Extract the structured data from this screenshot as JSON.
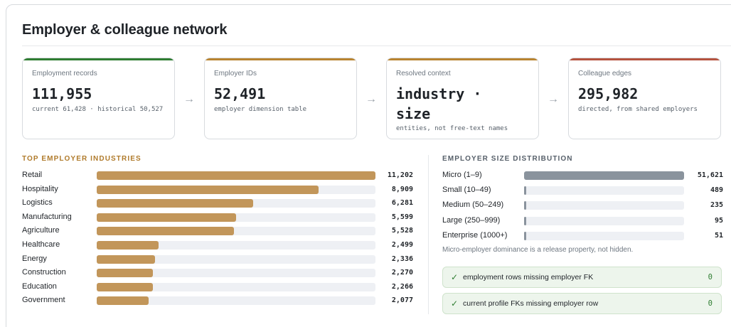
{
  "header": {
    "title": "Employer & colleague network"
  },
  "colors": {
    "green": "#2f7d32",
    "gold": "#c2965a",
    "amber": "#b98430",
    "red": "#b5533f",
    "grey_bar": "#8a939d",
    "section_gold": "#b07b2c"
  },
  "pipeline": {
    "arrow": "→",
    "cards": [
      {
        "label": "Employment records",
        "value": "111,955",
        "sub": "current 61,428 · historical 50,527",
        "accent": "#2f7d32"
      },
      {
        "label": "Employer IDs",
        "value": "52,491",
        "sub": "employer dimension table",
        "accent": "#b98430"
      },
      {
        "label": "Resolved context",
        "value": "industry · size",
        "sub": "entities, not free-text names",
        "accent": "#b98430"
      },
      {
        "label": "Colleague edges",
        "value": "295,982",
        "sub": "directed, from shared employers",
        "accent": "#b5533f"
      }
    ]
  },
  "industries": {
    "title": "TOP EMPLOYER INDUSTRIES",
    "max": 11202,
    "items": [
      {
        "name": "Retail",
        "value": 11202,
        "label": "11,202"
      },
      {
        "name": "Hospitality",
        "value": 8909,
        "label": "8,909"
      },
      {
        "name": "Logistics",
        "value": 6281,
        "label": "6,281"
      },
      {
        "name": "Manufacturing",
        "value": 5599,
        "label": "5,599"
      },
      {
        "name": "Agriculture",
        "value": 5528,
        "label": "5,528"
      },
      {
        "name": "Healthcare",
        "value": 2499,
        "label": "2,499"
      },
      {
        "name": "Energy",
        "value": 2336,
        "label": "2,336"
      },
      {
        "name": "Construction",
        "value": 2270,
        "label": "2,270"
      },
      {
        "name": "Education",
        "value": 2266,
        "label": "2,266"
      },
      {
        "name": "Government",
        "value": 2077,
        "label": "2,077"
      }
    ]
  },
  "sizes": {
    "title": "EMPLOYER SIZE DISTRIBUTION",
    "max": 51621,
    "items": [
      {
        "name": "Micro (1–9)",
        "value": 51621,
        "label": "51,621"
      },
      {
        "name": "Small (10–49)",
        "value": 489,
        "label": "489"
      },
      {
        "name": "Medium (50–249)",
        "value": 235,
        "label": "235"
      },
      {
        "name": "Large (250–999)",
        "value": 95,
        "label": "95"
      },
      {
        "name": "Enterprise (1000+)",
        "value": 51,
        "label": "51"
      }
    ],
    "note": "Micro-employer dominance is a release property, not hidden."
  },
  "checks": [
    {
      "icon": "✓",
      "text": "employment rows missing employer FK",
      "value": "0"
    },
    {
      "icon": "✓",
      "text": "current profile FKs missing employer row",
      "value": "0"
    }
  ]
}
